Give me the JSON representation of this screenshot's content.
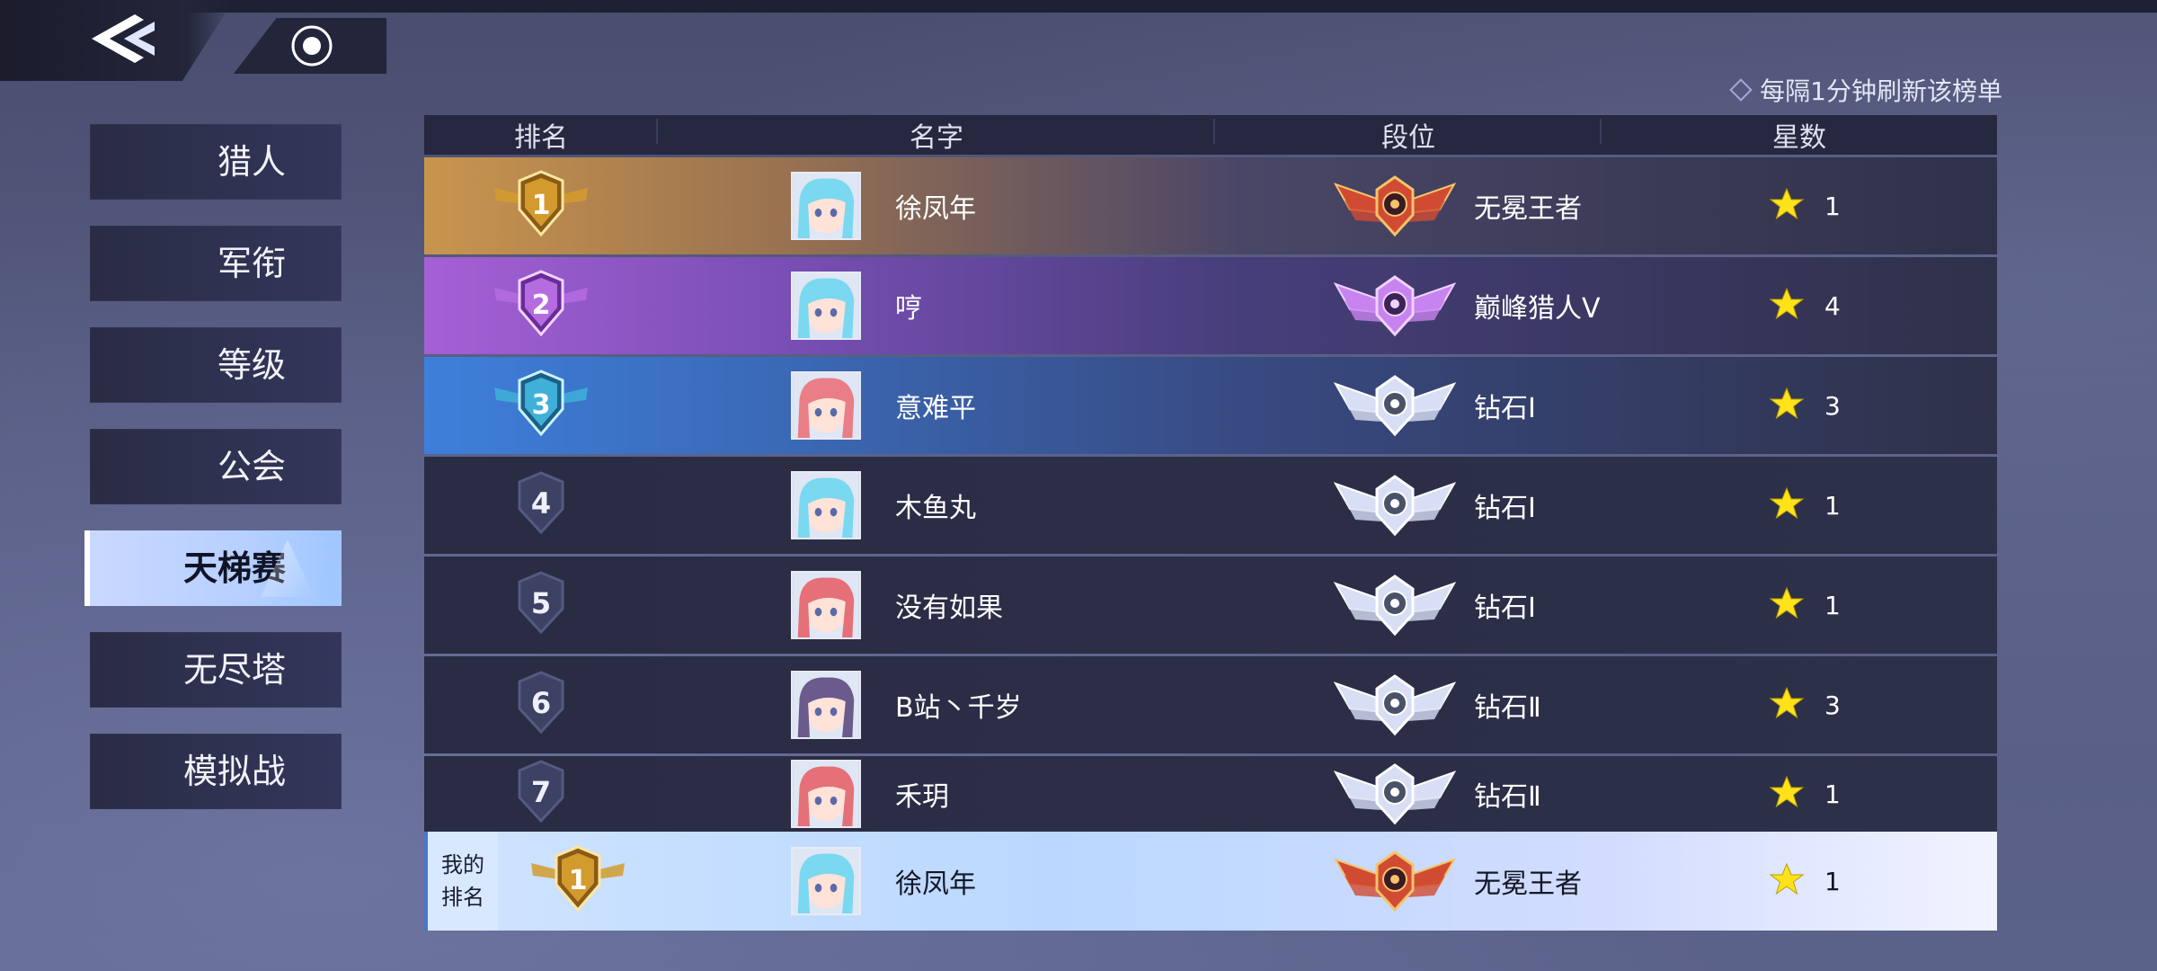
{
  "header": {
    "back_icon": "back-chevron-icon",
    "camera_icon": "record-icon",
    "refresh_notice": "每隔1分钟刷新该榜单"
  },
  "menu": [
    {
      "label": "猎人",
      "active": false
    },
    {
      "label": "军衔",
      "active": false
    },
    {
      "label": "等级",
      "active": false
    },
    {
      "label": "公会",
      "active": false
    },
    {
      "label": "天梯赛",
      "active": true
    },
    {
      "label": "无尽塔",
      "active": false
    },
    {
      "label": "模拟战",
      "active": false
    }
  ],
  "table": {
    "columns": {
      "rank": "排名",
      "name": "名字",
      "tier": "段位",
      "stars": "星数"
    },
    "rows": [
      {
        "rank": "1",
        "name": "徐凤年",
        "tier": "无冕王者",
        "stars": "1"
      },
      {
        "rank": "2",
        "name": "哼",
        "tier": "巅峰猎人Ⅴ",
        "stars": "4"
      },
      {
        "rank": "3",
        "name": "意难平",
        "tier": "钻石Ⅰ",
        "stars": "3"
      },
      {
        "rank": "4",
        "name": "木鱼丸",
        "tier": "钻石Ⅰ",
        "stars": "1"
      },
      {
        "rank": "5",
        "name": "没有如果",
        "tier": "钻石Ⅰ",
        "stars": "1"
      },
      {
        "rank": "6",
        "name": "B站丶千岁",
        "tier": "钻石Ⅱ",
        "stars": "3"
      },
      {
        "rank": "7",
        "name": "禾玥",
        "tier": "钻石Ⅱ",
        "stars": "1"
      }
    ]
  },
  "my_rank": {
    "label_line1": "我的",
    "label_line2": "排名",
    "rank": "1",
    "name": "徐凤年",
    "tier": "无冕王者",
    "stars": "1"
  },
  "colors": {
    "gold": "#d9a13a",
    "purple": "#a25fd8",
    "blue": "#3b7fe0",
    "star": "#ffe21a"
  }
}
